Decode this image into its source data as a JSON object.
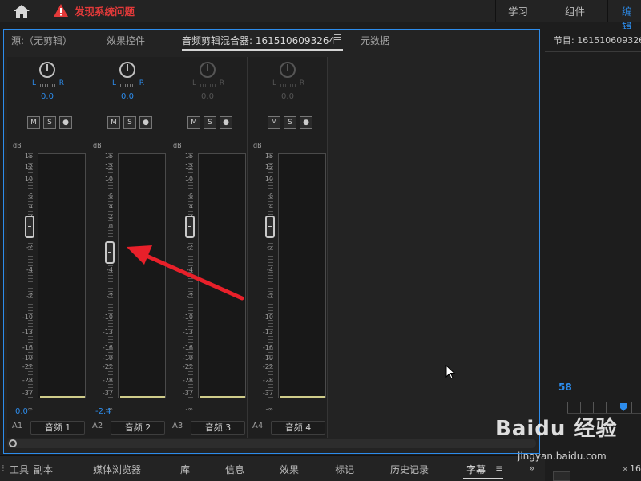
{
  "topbar": {
    "warning_text": "发现系统问题",
    "workspaces": [
      "学习",
      "组件",
      "编辑"
    ],
    "accent": "#2d8ceb",
    "warning_color": "#e33a3a"
  },
  "panel": {
    "tabs": [
      {
        "label": "源:（无剪辑）"
      },
      {
        "label": "效果控件"
      },
      {
        "label": "音频剪辑混合器: 1615106093264"
      },
      {
        "label": "元数据"
      }
    ],
    "db_label": "dB",
    "scale_ticks": [
      "15",
      "12",
      "10",
      "6",
      "4",
      "2",
      "0",
      "-2",
      "-4",
      "-7",
      "-10",
      "-13",
      "-16",
      "-19",
      "-22",
      "-28",
      "-37",
      "-∞"
    ],
    "msb": [
      "M",
      "S",
      "●"
    ],
    "channels": [
      {
        "id": "A1",
        "name": "音频 1",
        "pan": "0.0",
        "volume": "0.0",
        "fader_db": 0,
        "enabled": true
      },
      {
        "id": "A2",
        "name": "音频 2",
        "pan": "0.0",
        "volume": "-2.4",
        "fader_db": -2.4,
        "enabled": true
      },
      {
        "id": "A3",
        "name": "音频 3",
        "pan": "0.0",
        "volume": "",
        "fader_db": 0,
        "enabled": false
      },
      {
        "id": "A4",
        "name": "音频 4",
        "pan": "0.0",
        "volume": "",
        "fader_db": 0,
        "enabled": false
      }
    ],
    "pan_l": "L",
    "pan_r": "R"
  },
  "program": {
    "title": "节目: 1615106093264",
    "timecode": "58"
  },
  "bottom": {
    "tabs": [
      "工具_副本",
      "媒体浏览器",
      "库",
      "信息",
      "效果",
      "标记",
      "历史记录",
      "字幕"
    ],
    "overflow": "»",
    "right_num": "16",
    "close": "×"
  },
  "watermark": {
    "brand": "Baidu 经验",
    "url": "jingyan.baidu.com"
  }
}
